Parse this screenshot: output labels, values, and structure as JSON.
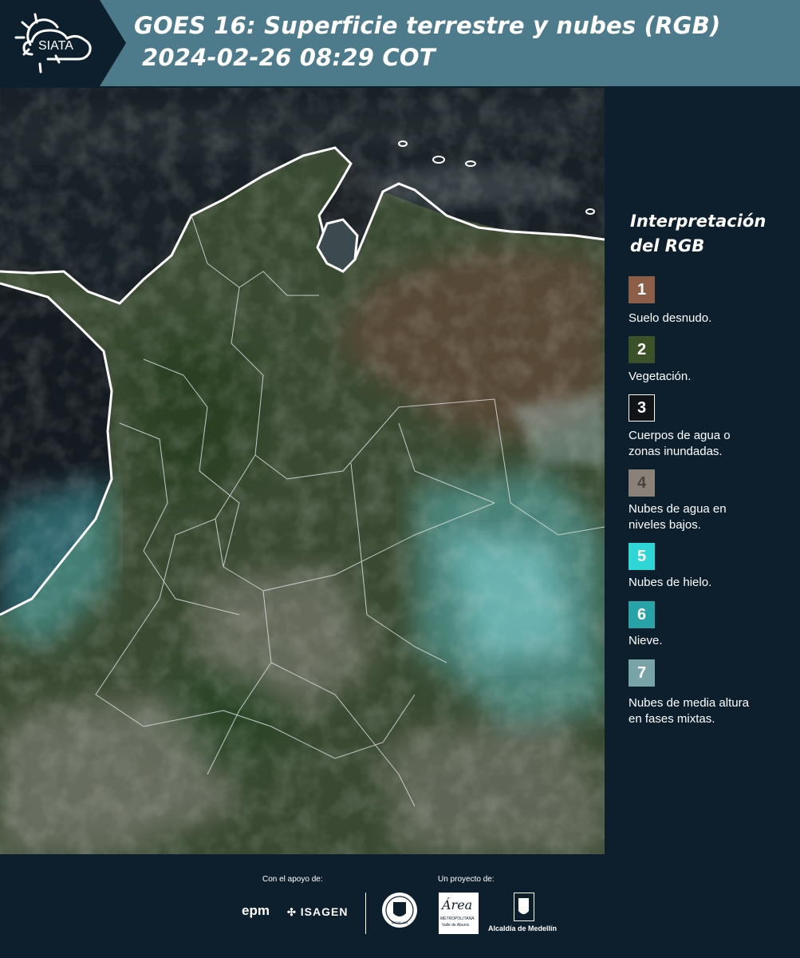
{
  "header": {
    "logo_text": "SIATA",
    "title_line1": "GOES 16: Superficie terrestre y nubes (RGB)",
    "title_line2": "2024-02-26 08:29 COT",
    "background_color": "#4e7b8b"
  },
  "legend": {
    "title_line1": "Interpretación",
    "title_line2": "del RGB",
    "items": [
      {
        "number": "1",
        "label_line1": "Suelo desnudo.",
        "label_line2": "",
        "color": "#8c5e48"
      },
      {
        "number": "2",
        "label_line1": "Vegetación.",
        "label_line2": "",
        "color": "#3b5228"
      },
      {
        "number": "3",
        "label_line1": "Cuerpos de agua o",
        "label_line2": "zonas inundadas.",
        "color": "#101418"
      },
      {
        "number": "4",
        "label_line1": "Nubes de agua en",
        "label_line2": "niveles bajos.",
        "color": "#8a8178"
      },
      {
        "number": "5",
        "label_line1": "Nubes de hielo.",
        "label_line2": "",
        "color": "#2fd6d6"
      },
      {
        "number": "6",
        "label_line1": "Nieve.",
        "label_line2": "",
        "color": "#27a3a8"
      },
      {
        "number": "7",
        "label_line1": "Nubes de media altura",
        "label_line2": "en fases mixtas.",
        "color": "#78a4a8"
      }
    ]
  },
  "footer": {
    "support_label": "Con el apoyo de:",
    "project_label": "Un proyecto de:",
    "sponsor_epm": "epm",
    "sponsor_isagen": "ISAGEN",
    "org_area_name": "Área",
    "org_area_sub1": "METROPOLITANA",
    "org_area_sub2": "Valle de Aburrá",
    "org_alcaldia": "Alcaldía de Medellín",
    "org_medellin": "MEDELLIN"
  }
}
